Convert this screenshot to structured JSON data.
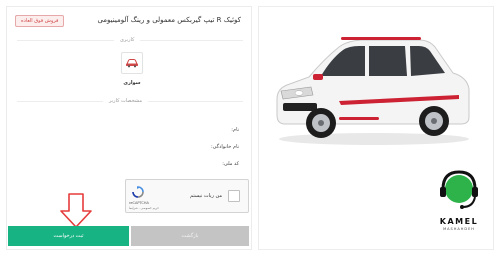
{
  "form": {
    "title": "کوئیک R تیپ گیربکس معمولی و رینگ آلومینیومی",
    "badge": "فروش فوق العاده",
    "usage_section": "کاربری",
    "usage_option": "سواری",
    "buyer_section": "مشخصات کاربر",
    "fields": {
      "name": "نام:",
      "family": "نام خانوادگی:",
      "national_code": "کد ملی:"
    }
  },
  "captcha": {
    "label": "من ربات نیستم",
    "brand": "reCAPTCHA",
    "links": "حریم خصوصی - شرایط"
  },
  "buttons": {
    "submit": "ثبت درخواست",
    "back": "بازگشت"
  },
  "brand": {
    "name": "KAMEL",
    "tagline": "MASHAHDEH"
  },
  "colors": {
    "submit": "#18b383",
    "back": "#c4c4c4",
    "badge": "#d04848"
  }
}
